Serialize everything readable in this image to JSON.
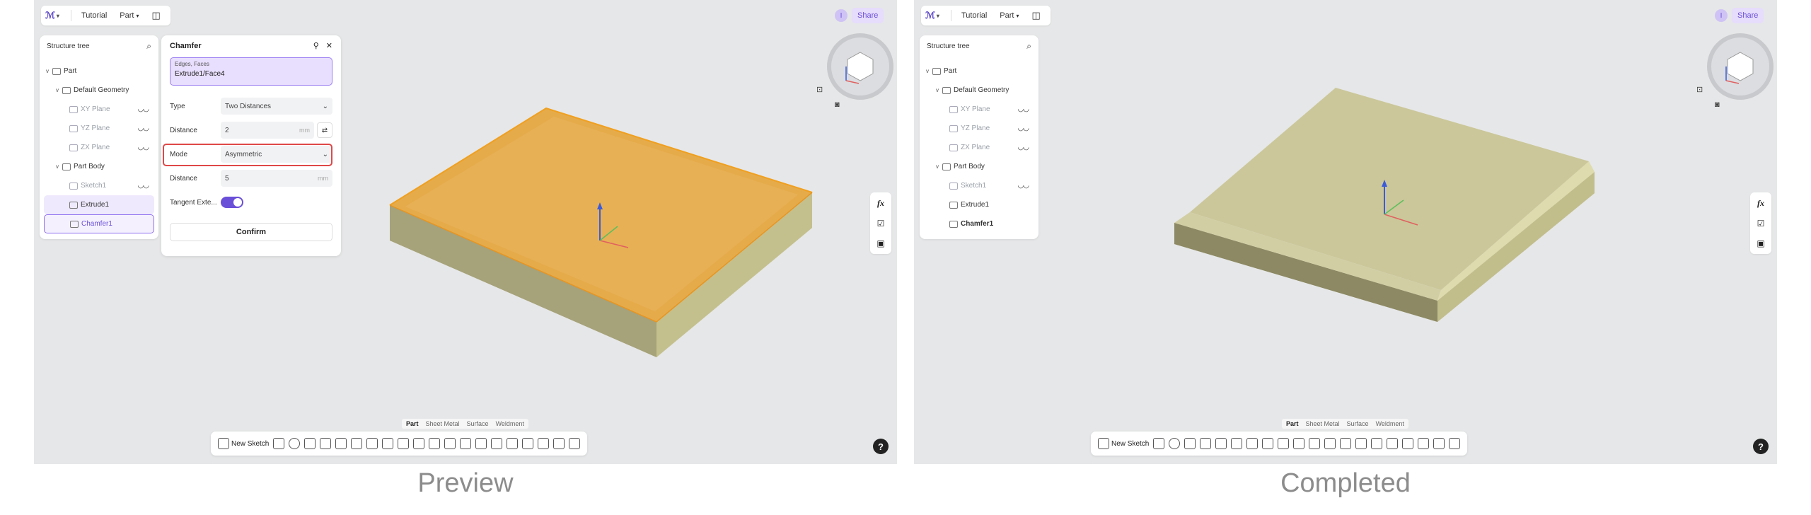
{
  "captions": {
    "left": "Preview",
    "right": "Completed"
  },
  "topbar": {
    "doc_name": "Tutorial",
    "mode_label": "Part"
  },
  "share": {
    "avatar": "I",
    "share_label": "Share"
  },
  "tree": {
    "title": "Structure tree",
    "items": [
      {
        "label": "Part"
      },
      {
        "label": "Default Geometry"
      },
      {
        "label": "XY Plane"
      },
      {
        "label": "YZ Plane"
      },
      {
        "label": "ZX Plane"
      },
      {
        "label": "Part Body"
      },
      {
        "label": "Sketch1"
      },
      {
        "label": "Extrude1"
      },
      {
        "label": "Chamfer1"
      }
    ]
  },
  "dialog": {
    "title": "Chamfer",
    "selection_label": "Edges, Faces",
    "selection_value": "Extrude1/Face4",
    "type_label": "Type",
    "type_value": "Two Distances",
    "distance1_label": "Distance",
    "distance1_value": "2",
    "distance1_unit": "mm",
    "mode_label": "Mode",
    "mode_value": "Asymmetric",
    "distance2_label": "Distance",
    "distance2_value": "5",
    "distance2_unit": "mm",
    "tangent_label": "Tangent Exte...",
    "tangent_on": true,
    "confirm_label": "Confirm"
  },
  "category_tabs": [
    "Part",
    "Sheet Metal",
    "Surface",
    "Weldment"
  ],
  "toolbar": {
    "new_sketch": "New Sketch"
  },
  "sidetools": {
    "fx": "fx"
  },
  "help": "?",
  "colors": {
    "accent": "#6a4fd8",
    "highlight_red": "#e04848",
    "preview_orange": "#e8a02c",
    "solid_khaki": "#c9c694"
  }
}
